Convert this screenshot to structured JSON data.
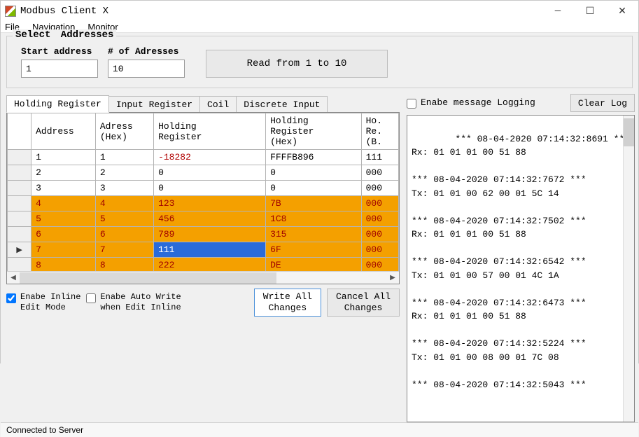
{
  "window": {
    "title": "Modbus Client X"
  },
  "menu": {
    "file": "File",
    "navigation": "Navigation",
    "monitor": "Monitor"
  },
  "group": {
    "legend": "Select  Addresses",
    "start_label": "Start address",
    "count_label": "# of Adresses",
    "start_value": "1",
    "count_value": "10",
    "read_label": "Read from 1 to 10"
  },
  "tabs": {
    "holding": "Holding Register",
    "input": "Input Register",
    "coil": "Coil",
    "discrete": "Discrete Input"
  },
  "grid": {
    "headers": {
      "address": "Address",
      "addr_hex": "Adress\n(Hex)",
      "holding": "Holding\nRegister",
      "holding_hex": "Holding\nRegister\n(Hex)",
      "holding_bin": "Ho.\nRe.\n(B."
    },
    "rows": [
      {
        "addr": "1",
        "hex": "1",
        "hold": "-18282",
        "hhex": "FFFFB896",
        "bin": "111",
        "style": "white neg",
        "indicator": ""
      },
      {
        "addr": "2",
        "hex": "2",
        "hold": "0",
        "hhex": "0",
        "bin": "000",
        "style": "white",
        "indicator": ""
      },
      {
        "addr": "3",
        "hex": "3",
        "hold": "0",
        "hhex": "0",
        "bin": "000",
        "style": "white",
        "indicator": ""
      },
      {
        "addr": "4",
        "hex": "4",
        "hold": "123",
        "hhex": "7B",
        "bin": "000",
        "style": "orange",
        "indicator": ""
      },
      {
        "addr": "5",
        "hex": "5",
        "hold": "456",
        "hhex": "1C8",
        "bin": "000",
        "style": "orange",
        "indicator": ""
      },
      {
        "addr": "6",
        "hex": "6",
        "hold": "789",
        "hhex": "315",
        "bin": "000",
        "style": "orange",
        "indicator": ""
      },
      {
        "addr": "7",
        "hex": "7",
        "hold": "111",
        "hhex": "6F",
        "bin": "000",
        "style": "orange editing",
        "indicator": "▶"
      },
      {
        "addr": "8",
        "hex": "8",
        "hold": "222",
        "hhex": "DE",
        "bin": "000",
        "style": "orange",
        "indicator": ""
      }
    ]
  },
  "footer": {
    "inline_label": "Enabe Inline\nEdit Mode",
    "inline_checked": true,
    "autowrite_label": "Enabe Auto Write\nwhen Edit Inline",
    "autowrite_checked": false,
    "write_all": "Write All\nChanges",
    "cancel_all": "Cancel All\nChanges"
  },
  "right": {
    "logging_label": "Enabe message Logging",
    "logging_checked": false,
    "clear_label": "Clear Log"
  },
  "log": "*** 08-04-2020 07:14:32:8691 ***\nRx: 01 01 01 00 51 88\n\n*** 08-04-2020 07:14:32:7672 ***\nTx: 01 01 00 62 00 01 5C 14\n\n*** 08-04-2020 07:14:32:7502 ***\nRx: 01 01 01 00 51 88\n\n*** 08-04-2020 07:14:32:6542 ***\nTx: 01 01 00 57 00 01 4C 1A\n\n*** 08-04-2020 07:14:32:6473 ***\nRx: 01 01 01 00 51 88\n\n*** 08-04-2020 07:14:32:5224 ***\nTx: 01 01 00 08 00 01 7C 08\n\n*** 08-04-2020 07:14:32:5043 ***",
  "status": "Connected to Server"
}
